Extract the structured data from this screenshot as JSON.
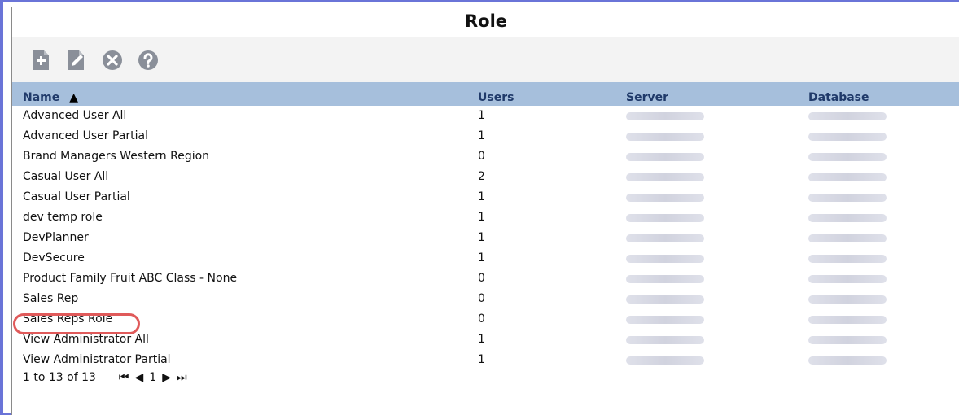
{
  "title": "Role",
  "toolbar": {
    "icons": [
      "new-document-icon",
      "edit-document-icon",
      "delete-circle-icon",
      "help-icon"
    ]
  },
  "table": {
    "columns": {
      "name": "Name",
      "users": "Users",
      "server": "Server",
      "database": "Database"
    },
    "sort_indicator": "▲",
    "rows": [
      {
        "name": "Advanced User All",
        "users": "1"
      },
      {
        "name": "Advanced User Partial",
        "users": "1"
      },
      {
        "name": "Brand Managers Western Region",
        "users": "0"
      },
      {
        "name": "Casual User All",
        "users": "2"
      },
      {
        "name": "Casual User Partial",
        "users": "1"
      },
      {
        "name": "dev temp role",
        "users": "1"
      },
      {
        "name": "DevPlanner",
        "users": "1"
      },
      {
        "name": "DevSecure",
        "users": "1"
      },
      {
        "name": "Product Family Fruit ABC Class - None",
        "users": "0"
      },
      {
        "name": "Sales Rep",
        "users": "0"
      },
      {
        "name": "Sales Reps Role",
        "users": "0"
      },
      {
        "name": "View Administrator All",
        "users": "1"
      },
      {
        "name": "View Administrator Partial",
        "users": "1"
      }
    ]
  },
  "pager": {
    "summary": "1 to 13 of 13",
    "first": "⏮",
    "prev": "◀",
    "page": "1",
    "next": "▶",
    "last": "⏭"
  },
  "colors": {
    "frame": "#6a74d8",
    "header_bg": "#a6bfdc",
    "highlight": "#e05a5a"
  }
}
